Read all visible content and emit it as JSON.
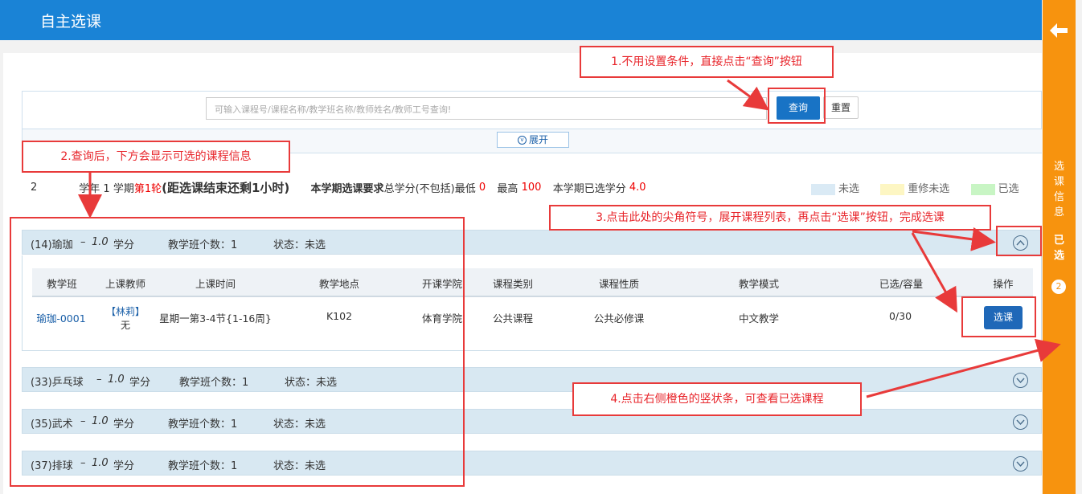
{
  "header": {
    "title": "自主选课"
  },
  "search": {
    "placeholder": "可输入课程号/课程名称/教学班名称/教师姓名/教师工号查询!",
    "query_label": "查询",
    "reset_label": "重置",
    "expand_label": "展开"
  },
  "info": {
    "term_prefix": "2",
    "term_text": "学年 1 学期",
    "round": "第1轮",
    "countdown": "(距选课结束还剩1小时)",
    "req_label": "本学期选课要求",
    "req_text": "总学分(不包括)最低",
    "min_credit": "0",
    "max_label": "最高",
    "max_credit": "100",
    "selected_label": "本学期已选学分",
    "selected_credit": "4.0",
    "legend": [
      {
        "label": "未选",
        "color": "#daeaf5"
      },
      {
        "label": "重修未选",
        "color": "#fdf6c3"
      },
      {
        "label": "已选",
        "color": "#c8f5c4"
      }
    ]
  },
  "groups": [
    {
      "code": "(14)瑜珈",
      "credit": "1.0",
      "credit_unit": "学分",
      "count_label": "教学班个数：1",
      "status_label": "状态：未选",
      "expanded": true
    },
    {
      "code": "(33)乒乓球",
      "credit": "1.0",
      "credit_unit": "学分",
      "count_label": "教学班个数：1",
      "status_label": "状态：未选",
      "expanded": false
    },
    {
      "code": "(35)武术",
      "credit": "1.0",
      "credit_unit": "学分",
      "count_label": "教学班个数：1",
      "status_label": "状态：未选",
      "expanded": false
    },
    {
      "code": "(37)排球",
      "credit": "1.0",
      "credit_unit": "学分",
      "count_label": "教学班个数：1",
      "status_label": "状态：未选",
      "expanded": false
    }
  ],
  "table": {
    "columns": [
      "教学班",
      "上课教师",
      "上课时间",
      "教学地点",
      "开课学院",
      "课程类别",
      "课程性质",
      "教学模式",
      "已选/容量",
      "操作"
    ],
    "row": {
      "class_name": "瑜珈-0001",
      "teacher": "【林莉】",
      "teacher_sub": "无",
      "time": "星期一第3-4节{1-16周}",
      "location": "K102",
      "college": "体育学院",
      "category": "公共课程",
      "nature": "公共必修课",
      "mode": "中文教学",
      "capacity": "0/30",
      "action": "选课"
    }
  },
  "sidebar": {
    "back_icon": "arrow-left-icon",
    "label1": "选课信息",
    "label2": "已选",
    "badge": "2"
  },
  "annotations": {
    "a1": "1.不用设置条件，直接点击“查询”按钮",
    "a2": "2.查询后，下方会显示可选的课程信息",
    "a3": "3.点击此处的尖角符号，展开课程列表，再点击“选课”按钮，完成选课",
    "a4": "4.点击右侧橙色的竖状条，可查看已选课程"
  }
}
